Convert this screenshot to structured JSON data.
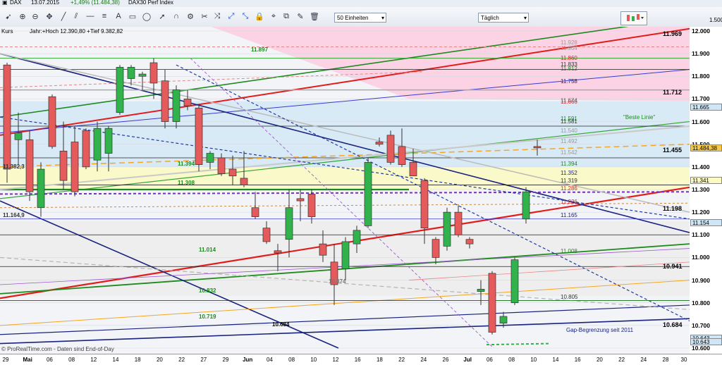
{
  "title": {
    "symbol": "DAX",
    "date": "13.07.2015",
    "change": "+1,49% (11.484,38)",
    "instrument": "DAX30 Perf Index"
  },
  "toolbar": {
    "units_select": "50 Einheiten",
    "period_select": "Täglich",
    "mini_label": "1.500"
  },
  "legend": {
    "kurs": "Kurs",
    "text": "Jahr:+Hoch 12.390,80 +Tief 9.382,82"
  },
  "source": "© ProRealTime.com - Daten sind End-of-Day",
  "colors": {
    "up": "#2fb34a",
    "down": "#e55b5b",
    "pink_zone": "#fbd3e5",
    "blue_zone": "#cfe6f7",
    "yellow_zone": "#fdfbc4",
    "grey_zone": "#ececec",
    "red_line": "#e21b1b",
    "green_line": "#1d8a1d",
    "navy_line": "#1a237e"
  },
  "chart_data": {
    "type": "candlestick",
    "ylim": [
      10600,
      12000
    ],
    "y_ticks": [
      "12.000",
      "11.900",
      "11.800",
      "11.700",
      "11.600",
      "11.500",
      "11.400",
      "11.300",
      "11.200",
      "11.100",
      "11.000",
      "10.900",
      "10.800",
      "10.700",
      "10.600"
    ],
    "x_ticks": [
      {
        "label": "29"
      },
      {
        "label": "Mai",
        "month": true
      },
      {
        "label": "06"
      },
      {
        "label": "08"
      },
      {
        "label": "12"
      },
      {
        "label": "14"
      },
      {
        "label": "18"
      },
      {
        "label": "20"
      },
      {
        "label": "22"
      },
      {
        "label": "27"
      },
      {
        "label": "29"
      },
      {
        "label": "Jun",
        "month": true
      },
      {
        "label": "04"
      },
      {
        "label": "08"
      },
      {
        "label": "10"
      },
      {
        "label": "12"
      },
      {
        "label": "16"
      },
      {
        "label": "18"
      },
      {
        "label": "22"
      },
      {
        "label": "24"
      },
      {
        "label": "26"
      },
      {
        "label": "Jul",
        "month": true
      },
      {
        "label": "06"
      },
      {
        "label": "08"
      },
      {
        "label": "10"
      },
      {
        "label": "14"
      },
      {
        "label": "16"
      },
      {
        "label": "20"
      },
      {
        "label": "22"
      },
      {
        "label": "24"
      },
      {
        "label": "28"
      },
      {
        "label": "30"
      }
    ],
    "candles": [
      {
        "o": 11850,
        "h": 11860,
        "l": 11330,
        "c": 11390
      },
      {
        "o": 11520,
        "h": 11640,
        "l": 11410,
        "c": 11550
      },
      {
        "o": 11520,
        "h": 11560,
        "l": 11250,
        "c": 11290
      },
      {
        "o": 11220,
        "h": 11420,
        "l": 11180,
        "c": 11390
      },
      {
        "o": 11710,
        "h": 11720,
        "l": 11480,
        "c": 11490
      },
      {
        "o": 11470,
        "h": 11600,
        "l": 11300,
        "c": 11340
      },
      {
        "o": 11510,
        "h": 11580,
        "l": 11270,
        "c": 11290
      },
      {
        "o": 11560,
        "h": 11570,
        "l": 11390,
        "c": 11400
      },
      {
        "o": 11430,
        "h": 11600,
        "l": 11380,
        "c": 11570
      },
      {
        "o": 11460,
        "h": 11580,
        "l": 11380,
        "c": 11570
      },
      {
        "o": 11640,
        "h": 11850,
        "l": 11630,
        "c": 11840
      },
      {
        "o": 11790,
        "h": 11850,
        "l": 11760,
        "c": 11840
      },
      {
        "o": 11800,
        "h": 11820,
        "l": 11740,
        "c": 11810
      },
      {
        "o": 11860,
        "h": 11880,
        "l": 11700,
        "c": 11770
      },
      {
        "o": 11780,
        "h": 11830,
        "l": 11570,
        "c": 11600
      },
      {
        "o": 11600,
        "h": 11760,
        "l": 11570,
        "c": 11740
      },
      {
        "o": 11700,
        "h": 11740,
        "l": 11650,
        "c": 11670
      },
      {
        "o": 11660,
        "h": 11670,
        "l": 11380,
        "c": 11410
      },
      {
        "o": 11420,
        "h": 11470,
        "l": 11390,
        "c": 11460
      },
      {
        "o": 11440,
        "h": 11460,
        "l": 11360,
        "c": 11370
      },
      {
        "o": 11390,
        "h": 11450,
        "l": 11320,
        "c": 11360
      },
      {
        "o": 11350,
        "h": 11470,
        "l": 11310,
        "c": 11320
      },
      {
        "o": 11220,
        "h": 11290,
        "l": 11170,
        "c": 11180
      },
      {
        "o": 11130,
        "h": 11160,
        "l": 11060,
        "c": 11070
      },
      {
        "o": 11030,
        "h": 11060,
        "l": 10940,
        "c": 11020
      },
      {
        "o": 11080,
        "h": 11300,
        "l": 11000,
        "c": 11220
      },
      {
        "o": 11260,
        "h": 11300,
        "l": 11160,
        "c": 11250
      },
      {
        "o": 11280,
        "h": 11300,
        "l": 11150,
        "c": 11180
      },
      {
        "o": 11060,
        "h": 11120,
        "l": 10980,
        "c": 11010
      },
      {
        "o": 10980,
        "h": 11060,
        "l": 10790,
        "c": 10880
      },
      {
        "o": 10950,
        "h": 11090,
        "l": 10900,
        "c": 11070
      },
      {
        "o": 11060,
        "h": 11140,
        "l": 11020,
        "c": 11120
      },
      {
        "o": 11140,
        "h": 11440,
        "l": 11130,
        "c": 11420
      },
      {
        "o": 11510,
        "h": 11530,
        "l": 11490,
        "c": 11500
      },
      {
        "o": 11540,
        "h": 11560,
        "l": 11410,
        "c": 11420
      },
      {
        "o": 11490,
        "h": 11570,
        "l": 11400,
        "c": 11410
      },
      {
        "o": 11420,
        "h": 11480,
        "l": 11360,
        "c": 11360
      },
      {
        "o": 11340,
        "h": 11350,
        "l": 11060,
        "c": 11130
      },
      {
        "o": 11080,
        "h": 11090,
        "l": 10970,
        "c": 11000
      },
      {
        "o": 11050,
        "h": 11220,
        "l": 11030,
        "c": 11200
      },
      {
        "o": 11200,
        "h": 11230,
        "l": 11090,
        "c": 11100
      },
      {
        "o": 11080,
        "h": 11090,
        "l": 11040,
        "c": 11060
      },
      {
        "o": 10850,
        "h": 10900,
        "l": 10790,
        "c": 10860
      },
      {
        "o": 10930,
        "h": 10940,
        "l": 10660,
        "c": 10670
      },
      {
        "o": 10710,
        "h": 10760,
        "l": 10690,
        "c": 10740
      },
      {
        "o": 10800,
        "h": 11000,
        "l": 10790,
        "c": 10990
      },
      {
        "o": 11170,
        "h": 11310,
        "l": 11150,
        "c": 11290
      },
      {
        "o": 11490,
        "h": 11520,
        "l": 11450,
        "c": 11484
      }
    ],
    "level_labels": [
      {
        "text": "11.897",
        "y": 11897,
        "color": "#1d8a1d"
      },
      {
        "text": "11.394",
        "y": 11394,
        "color": "#1d8a1d"
      },
      {
        "text": "11.308",
        "y": 11308,
        "color": "#1d8a1d"
      },
      {
        "text": "11.014",
        "y": 11014,
        "color": "#1d8a1d"
      },
      {
        "text": "10.832",
        "y": 10832,
        "color": "#1d8a1d"
      },
      {
        "text": "10.719",
        "y": 10719,
        "color": "#1d8a1d"
      },
      {
        "text": "10.684",
        "y": 10684,
        "color": "#000000"
      },
      {
        "text": "11.382,3",
        "y": 11382,
        "color": "#333333"
      },
      {
        "text": "11.164,9",
        "y": 11165,
        "color": "#333333"
      },
      {
        "text": "10.874",
        "y": 10874,
        "color": "#777777"
      }
    ],
    "right_labels": [
      {
        "text": "11.928",
        "y": 11928,
        "color": "#999999"
      },
      {
        "text": "11.904",
        "y": 11904,
        "color": "#999999"
      },
      {
        "text": "11.860",
        "y": 11860,
        "color": "#e21b1b"
      },
      {
        "text": "11.833",
        "y": 11833,
        "color": "#333333"
      },
      {
        "text": "11.812",
        "y": 11812,
        "color": "#1d8a1d"
      },
      {
        "text": "11.758",
        "y": 11758,
        "color": "#1a237e"
      },
      {
        "text": "11.674",
        "y": 11674,
        "color": "#777777"
      },
      {
        "text": "11.666",
        "y": 11666,
        "color": "#e21b1b"
      },
      {
        "text": "11.591",
        "y": 11591,
        "color": "#1d8a1d"
      },
      {
        "text": "11.581",
        "y": 11581,
        "color": "#333333"
      },
      {
        "text": "11.540",
        "y": 11540,
        "color": "#999999"
      },
      {
        "text": "11.492",
        "y": 11492,
        "color": "#999999"
      },
      {
        "text": "11.542",
        "y": 11442,
        "color": "#999999"
      },
      {
        "text": "11.394",
        "y": 11394,
        "color": "#1d8a1d"
      },
      {
        "text": "11.352",
        "y": 11352,
        "color": "#1a237e"
      },
      {
        "text": "11.319",
        "y": 11319,
        "color": "#333333"
      },
      {
        "text": "11.286",
        "y": 11286,
        "color": "#e21b1b"
      },
      {
        "text": "11.226",
        "y": 11226,
        "color": "#e21b1b"
      },
      {
        "text": "11.165",
        "y": 11165,
        "color": "#1a237e"
      },
      {
        "text": "11.008",
        "y": 11008,
        "color": "#1d8a1d"
      },
      {
        "text": "10.805",
        "y": 10805,
        "color": "#333333"
      }
    ],
    "beste_linie": "\"Beste Linie\"",
    "gap_text": "Gap-Begrenzung seit 2011",
    "bold_right": [
      {
        "text": "11.969",
        "y": 11969
      },
      {
        "text": "11.712",
        "y": 11712
      },
      {
        "text": "11.455",
        "y": 11455
      },
      {
        "text": "11.198",
        "y": 11198
      },
      {
        "text": "10.941",
        "y": 10941
      },
      {
        "text": "10.684",
        "y": 10684
      }
    ],
    "scale_boxes": [
      {
        "text": "11.665",
        "y": 11665,
        "bg": "#cfe6f7"
      },
      {
        "text": "11.484,38",
        "y": 11484,
        "bg": "#f2c94c"
      },
      {
        "text": "11.341",
        "y": 11341,
        "bg": "#fdfbc4"
      },
      {
        "text": "11.154",
        "y": 11154,
        "bg": "#cfe6f7"
      },
      {
        "text": "10.643",
        "y": 10643,
        "bg": "#cfe6f7"
      },
      {
        "text": "10.643",
        "y": 10629,
        "bg": "#cfe6f7"
      }
    ]
  }
}
